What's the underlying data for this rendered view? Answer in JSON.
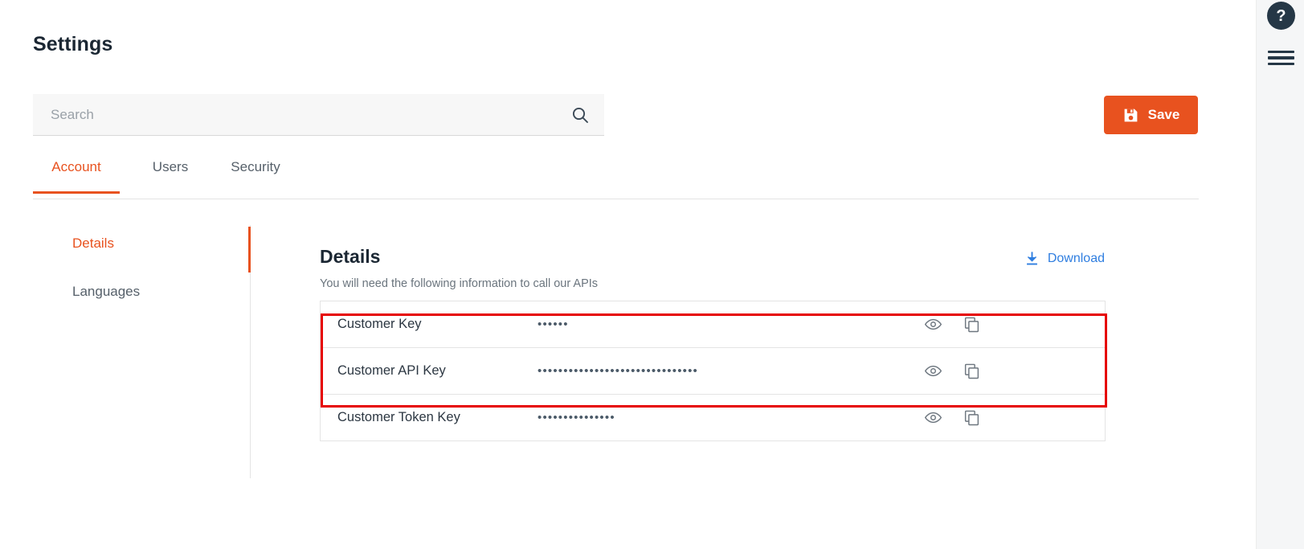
{
  "page": {
    "title": "Settings"
  },
  "search": {
    "placeholder": "Search",
    "value": "",
    "icon": "search-icon"
  },
  "toolbar": {
    "save_label": "Save",
    "save_icon": "floppy-disk-icon",
    "accent_color": "#e8521f"
  },
  "right_rail": {
    "help_label": "?",
    "help_icon": "question-mark-icon",
    "menu_icon": "hamburger-menu-icon"
  },
  "tabs": [
    {
      "label": "Account",
      "active": true
    },
    {
      "label": "Users",
      "active": false
    },
    {
      "label": "Security",
      "active": false
    }
  ],
  "subnav": [
    {
      "label": "Details",
      "active": true
    },
    {
      "label": "Languages",
      "active": false
    }
  ],
  "details": {
    "title": "Details",
    "subtitle": "You will need the following information to call our APIs",
    "download_label": "Download",
    "download_icon": "download-icon",
    "download_color": "#2f7ee0"
  },
  "keys": [
    {
      "label": "Customer Key",
      "value": "••••••",
      "reveal_icon": "eye-icon",
      "copy_icon": "copy-icon"
    },
    {
      "label": "Customer API Key",
      "value": "•••••••••••••••••••••••••••••••",
      "reveal_icon": "eye-icon",
      "copy_icon": "copy-icon"
    },
    {
      "label": "Customer Token Key",
      "value": "•••••••••••••••",
      "reveal_icon": "eye-icon",
      "copy_icon": "copy-icon"
    }
  ],
  "annotation": {
    "color": "#e60000"
  }
}
